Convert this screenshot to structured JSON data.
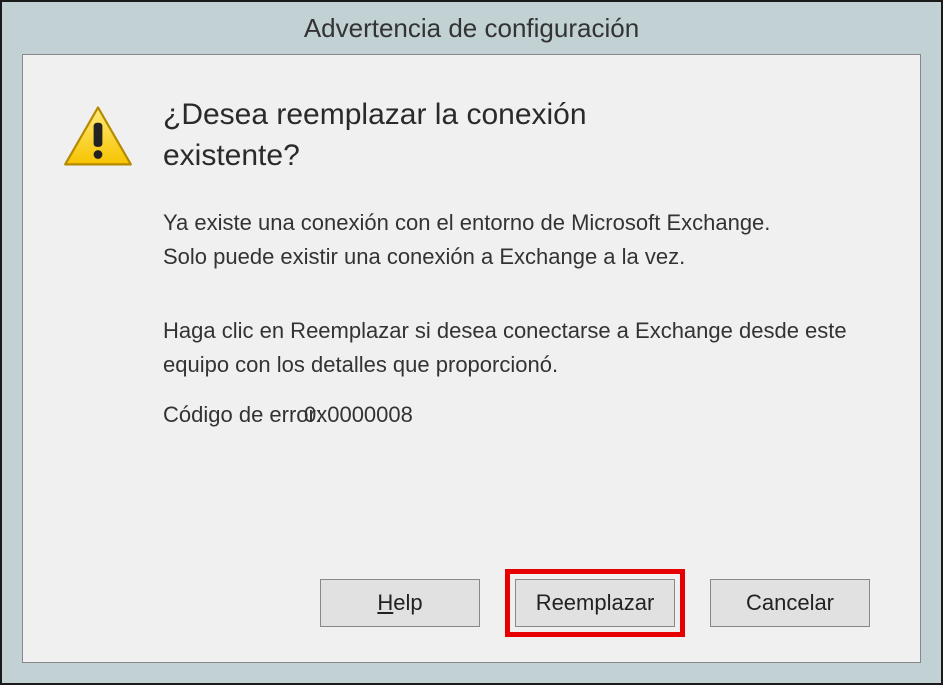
{
  "title": "Advertencia de configuración",
  "heading": "¿Desea reemplazar la conexión existente?",
  "paragraph1": "Ya existe una conexión con el entorno de Microsoft Exchange. Solo puede existir una conexión a Exchange a la vez.",
  "paragraph2": "Haga clic en Reemplazar si desea conectarse a Exchange desde este equipo con los detalles que proporcionó.",
  "error_label": "Código de error:",
  "error_code": "0x0000008",
  "buttons": {
    "help": "Help",
    "replace": "Reemplazar",
    "cancel": "Cancelar"
  }
}
